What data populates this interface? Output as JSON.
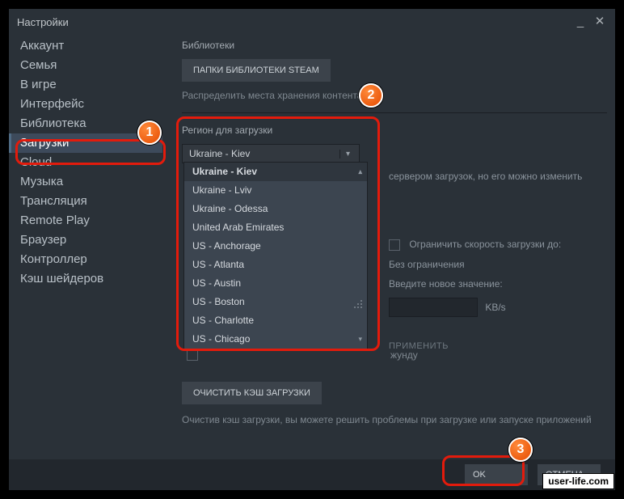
{
  "window": {
    "title": "Настройки"
  },
  "sidebar": {
    "items": [
      {
        "label": "Аккаунт"
      },
      {
        "label": "Семья"
      },
      {
        "label": "В игре"
      },
      {
        "label": "Интерфейс"
      },
      {
        "label": "Библиотека"
      },
      {
        "label": "Загрузки",
        "active": true
      },
      {
        "label": "Cloud"
      },
      {
        "label": "Музыка"
      },
      {
        "label": "Трансляция"
      },
      {
        "label": "Remote Play"
      },
      {
        "label": "Браузер"
      },
      {
        "label": "Контроллер"
      },
      {
        "label": "Кэш шейдеров"
      }
    ]
  },
  "content": {
    "libraries_title": "Библиотеки",
    "libraries_button": "ПАПКИ БИБЛИОТЕКИ STEAM",
    "libraries_subtext": "Распределить места хранения контента",
    "region_title": "Регион для загрузки",
    "region_selected": "Ukraine - Kiev",
    "region_hint_partial": "сервером загрузок, но его можно изменить",
    "limit": {
      "checkbox_label": "Ограничить скорость загрузки до:",
      "no_limit": "Без ограничения",
      "enter_new": "Введите новое значение:",
      "unit": "KB/s",
      "apply": "ПРИМЕНИТЬ"
    },
    "truncated_row": "жунду",
    "clear_button": "ОЧИСТИТЬ КЭШ ЗАГРУЗКИ",
    "clear_text": "Очистив кэш загрузки, вы можете решить проблемы при загрузке или запуске приложений"
  },
  "dropdown": {
    "items": [
      "Ukraine - Kiev",
      "Ukraine - Lviv",
      "Ukraine - Odessa",
      "United Arab Emirates",
      "US - Anchorage",
      "US - Atlanta",
      "US - Austin",
      "US - Boston",
      "US - Charlotte",
      "US - Chicago"
    ]
  },
  "footer": {
    "ok": "OK",
    "cancel": "ОТМЕНА"
  },
  "markers": {
    "m1": "1",
    "m2": "2",
    "m3": "3"
  },
  "watermark": "user-life.com"
}
